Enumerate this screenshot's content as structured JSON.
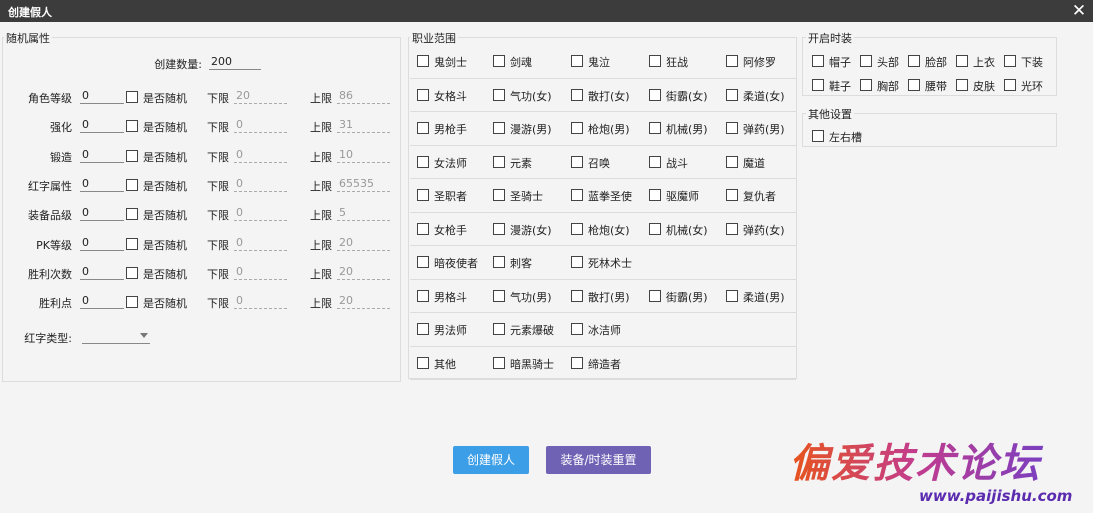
{
  "window": {
    "title": "创建假人",
    "close_icon": "✕"
  },
  "random_attrs": {
    "group_title": "随机属性",
    "create_count_label": "创建数量:",
    "create_count_value": "200",
    "random_label": "是否随机",
    "lower_label": "下限",
    "upper_label": "上限",
    "rows": [
      {
        "label": "角色等级",
        "value": "0",
        "lower": "20",
        "upper": "86"
      },
      {
        "label": "强化",
        "value": "0",
        "lower": "0",
        "upper": "31"
      },
      {
        "label": "锻造",
        "value": "0",
        "lower": "0",
        "upper": "10"
      },
      {
        "label": "红字属性",
        "value": "0",
        "lower": "0",
        "upper": "65535"
      },
      {
        "label": "装备品级",
        "value": "0",
        "lower": "0",
        "upper": "5"
      },
      {
        "label": "PK等级",
        "value": "0",
        "lower": "0",
        "upper": "20"
      },
      {
        "label": "胜利次数",
        "value": "0",
        "lower": "0",
        "upper": "20"
      },
      {
        "label": "胜利点",
        "value": "0",
        "lower": "0",
        "upper": "20"
      }
    ],
    "red_type_label": "红字类型:",
    "red_type_value": ""
  },
  "job_range": {
    "group_title": "职业范围",
    "rows": [
      [
        "鬼剑士",
        "剑魂",
        "鬼泣",
        "狂战",
        "阿修罗"
      ],
      [
        "女格斗",
        "气功(女)",
        "散打(女)",
        "街霸(女)",
        "柔道(女)"
      ],
      [
        "男枪手",
        "漫游(男)",
        "枪炮(男)",
        "机械(男)",
        "弹药(男)"
      ],
      [
        "女法师",
        "元素",
        "召唤",
        "战斗",
        "魔道"
      ],
      [
        "圣职者",
        "圣骑士",
        "蓝拳圣使",
        "驱魔师",
        "复仇者"
      ],
      [
        "女枪手",
        "漫游(女)",
        "枪炮(女)",
        "机械(女)",
        "弹药(女)"
      ],
      [
        "暗夜使者",
        "刺客",
        "死林术士"
      ],
      [
        "男格斗",
        "气功(男)",
        "散打(男)",
        "街霸(男)",
        "柔道(男)"
      ],
      [
        "男法师",
        "元素爆破",
        "冰洁师"
      ],
      [
        "其他",
        "暗黑骑士",
        "缔造者"
      ]
    ]
  },
  "fashion": {
    "group_title": "开启时装",
    "items": [
      [
        "帽子",
        "头部",
        "脸部",
        "上衣",
        "下装"
      ],
      [
        "鞋子",
        "胸部",
        "腰带",
        "皮肤",
        "光环"
      ]
    ]
  },
  "other": {
    "group_title": "其他设置",
    "items": [
      "左右槽"
    ]
  },
  "buttons": {
    "create": "创建假人",
    "reset": "装备/时装重置"
  },
  "watermark": {
    "title": "偏爱技术论坛",
    "url": "www.paijishu.com"
  }
}
